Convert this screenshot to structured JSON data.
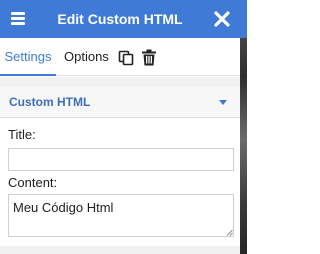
{
  "header": {
    "title": "Edit Custom HTML",
    "menu_icon": "hamburger-menu-icon",
    "close_icon": "close-icon",
    "background_color": "#3f7ad6"
  },
  "tabs": [
    {
      "label": "Settings",
      "active": true
    },
    {
      "label": "Options",
      "active": false
    }
  ],
  "tab_actions": {
    "copy_icon": "copy-icon",
    "delete_icon": "trash-icon"
  },
  "section": {
    "title": "Custom HTML",
    "expanded": true,
    "toggle_icon": "caret-down-icon"
  },
  "fields": {
    "title_label": "Title:",
    "title_value": "",
    "content_label": "Content:",
    "content_value": "Meu Código Html"
  },
  "colors": {
    "accent": "#3f7ad6",
    "section_title": "#3d6fb8"
  }
}
